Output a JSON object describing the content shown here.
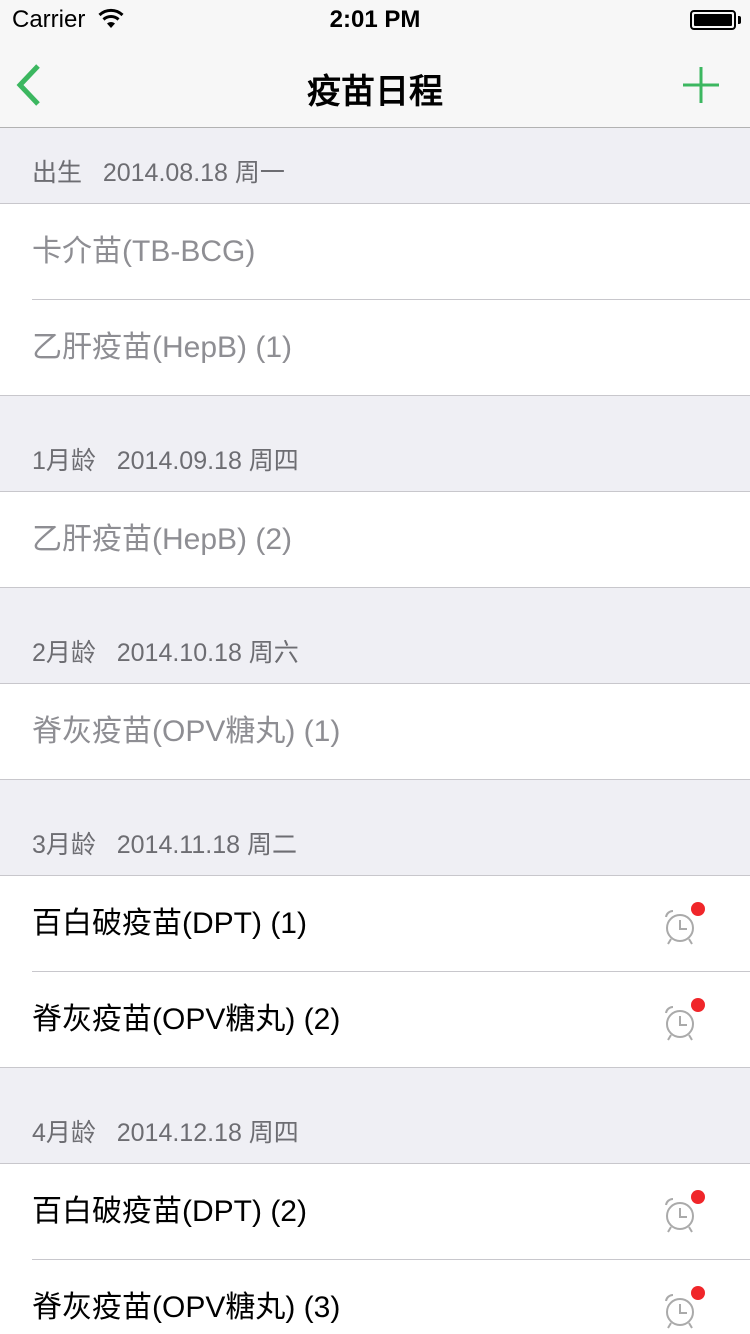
{
  "status": {
    "carrier": "Carrier",
    "time": "2:01 PM"
  },
  "nav": {
    "title": "疫苗日程",
    "back_icon": "chevron-left-icon",
    "add_icon": "plus-icon",
    "accent": "#3cb760"
  },
  "sections": [
    {
      "header": "出生   2014.08.18 周一",
      "items": [
        {
          "name": "卡介苗(TB-BCG)",
          "state": "done"
        },
        {
          "name": "乙肝疫苗(HepB) (1)",
          "state": "done"
        }
      ]
    },
    {
      "header": "1月龄   2014.09.18 周四",
      "items": [
        {
          "name": "乙肝疫苗(HepB) (2)",
          "state": "done"
        }
      ]
    },
    {
      "header": "2月龄   2014.10.18 周六",
      "items": [
        {
          "name": "脊灰疫苗(OPV糖丸) (1)",
          "state": "done"
        }
      ]
    },
    {
      "header": "3月龄   2014.11.18 周二",
      "items": [
        {
          "name": "百白破疫苗(DPT) (1)",
          "state": "due"
        },
        {
          "name": "脊灰疫苗(OPV糖丸) (2)",
          "state": "due"
        }
      ]
    },
    {
      "header": "4月龄   2014.12.18 周四",
      "items": [
        {
          "name": "百白破疫苗(DPT) (2)",
          "state": "due"
        },
        {
          "name": "脊灰疫苗(OPV糖丸) (3)",
          "state": "due"
        }
      ]
    }
  ]
}
